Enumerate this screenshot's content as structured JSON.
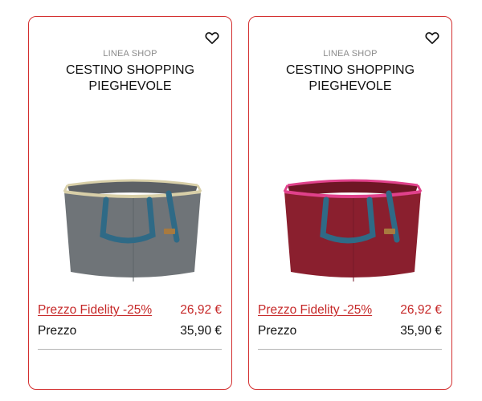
{
  "products": [
    {
      "brand": "LINEA SHOP",
      "title": "CESTINO SHOPPING PIEGHEVOLE",
      "fidelity_label": "Prezzo Fidelity -25%",
      "fidelity_price": "26,92 €",
      "price_label": "Prezzo",
      "price": "35,90 €",
      "image_icon": "gray-foldable-shopping-basket",
      "colors": {
        "body": "#6f7478",
        "rim": "#d8cfa8",
        "handles": "#2f6a86"
      }
    },
    {
      "brand": "LINEA SHOP",
      "title": "CESTINO SHOPPING PIEGHEVOLE",
      "fidelity_label": "Prezzo Fidelity -25%",
      "fidelity_price": "26,92 €",
      "price_label": "Prezzo",
      "price": "35,90 €",
      "image_icon": "burgundy-foldable-shopping-basket",
      "colors": {
        "body": "#8a1f2e",
        "rim": "#e0418b",
        "handles": "#2f6a86"
      }
    }
  ],
  "theme": {
    "accent": "#d32f2f",
    "fidelity_text": "#c62828"
  }
}
